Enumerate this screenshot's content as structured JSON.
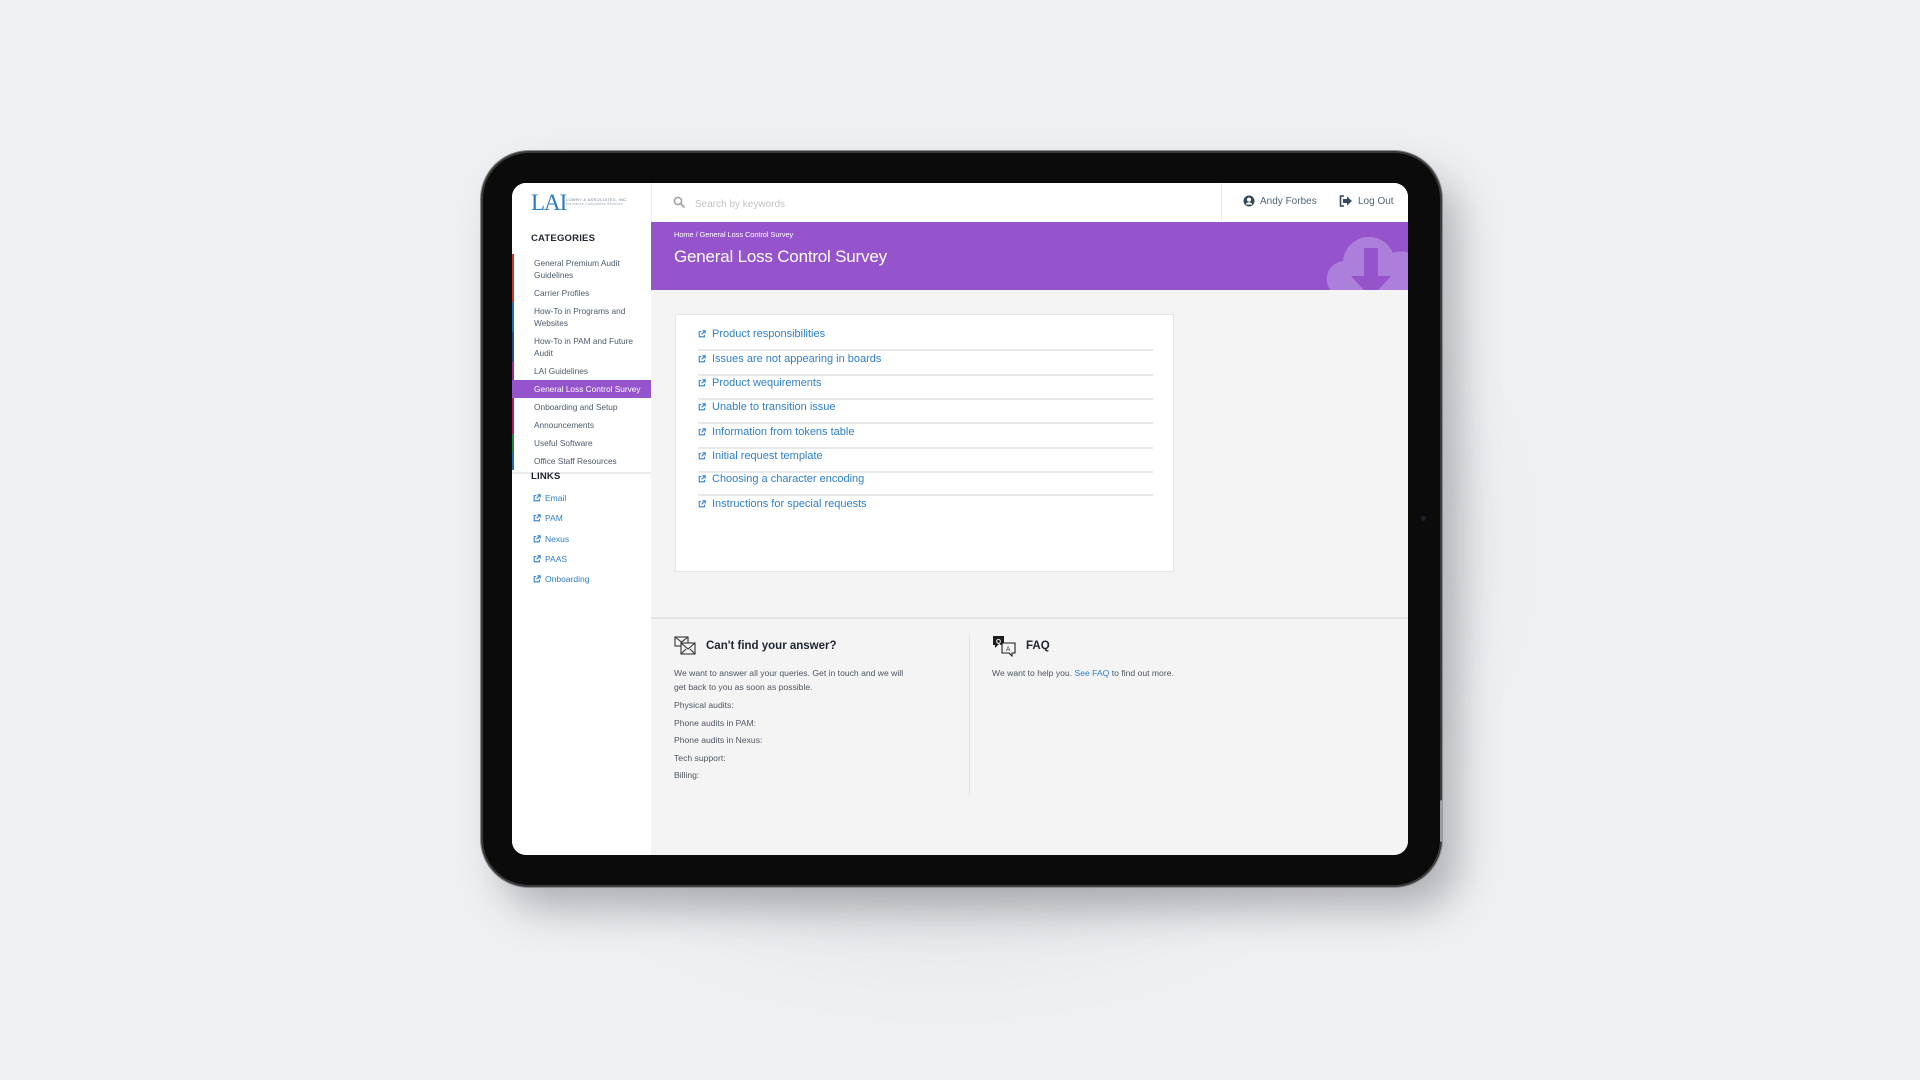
{
  "header": {
    "logo_mark": "LAI",
    "logo_company": "LOWRY & ASSOCIATES, INC.",
    "logo_tagline": "Insurance Companies Services",
    "search_placeholder": "Search by keywords",
    "user_name": "Andy Forbes",
    "logout_label": "Log Out"
  },
  "sidebar": {
    "categories_heading": "CATEGORIES",
    "categories": [
      {
        "label": "General Premium Audit Guidelines",
        "color": "#d9342b",
        "active": false
      },
      {
        "label": "Carrier Profiles",
        "color": "#d9342b",
        "active": false
      },
      {
        "label": "How-To in Programs and Websites",
        "color": "#1f6fb5",
        "active": false
      },
      {
        "label": "How-To in PAM and Future Audit",
        "color": "#2d4a8c",
        "active": false
      },
      {
        "label": "LAI Guidelines",
        "color": "#9c2fa0",
        "active": false
      },
      {
        "label": "General Loss Control Survey",
        "color": "#9553cc",
        "active": true
      },
      {
        "label": "Onboarding and Setup",
        "color": "#c2185b",
        "active": false
      },
      {
        "label": "Announcements",
        "color": "#c2185b",
        "active": false
      },
      {
        "label": "Useful Software",
        "color": "#1e8c3a",
        "active": false
      },
      {
        "label": "Office Staff Resources",
        "color": "#1f6fb5",
        "active": false
      }
    ],
    "links_heading": "LINKS",
    "links": [
      "Email",
      "PAM",
      "Nexus",
      "PAAS",
      "Onboarding"
    ]
  },
  "banner": {
    "breadcrumb": "Home / General Loss Control Survey",
    "title": "General Loss Control Survey",
    "color": "#9553cc"
  },
  "articles": [
    "Product responsibilities",
    "Issues are not appearing in boards",
    "Product wequirements",
    "Unable to transition issue",
    "Information from tokens table",
    "Initial request template",
    "Choosing a character encoding",
    "Instructions for special requests"
  ],
  "footer": {
    "contact": {
      "title": "Can't find your answer?",
      "text": "We want to answer all your queries. Get in touch and we will get back to you as soon as possible.",
      "rows": [
        "Physical audits:",
        "Phone audits in PAM:",
        "Phone audits in Nexus:",
        "Tech support:",
        "Billing:"
      ]
    },
    "faq": {
      "title": "FAQ",
      "text_before": "We want to help you.",
      "link": "See FAQ",
      "text_after": "to find out more."
    }
  },
  "colors": {
    "accent": "#9553cc",
    "link": "#2f7fc6"
  }
}
